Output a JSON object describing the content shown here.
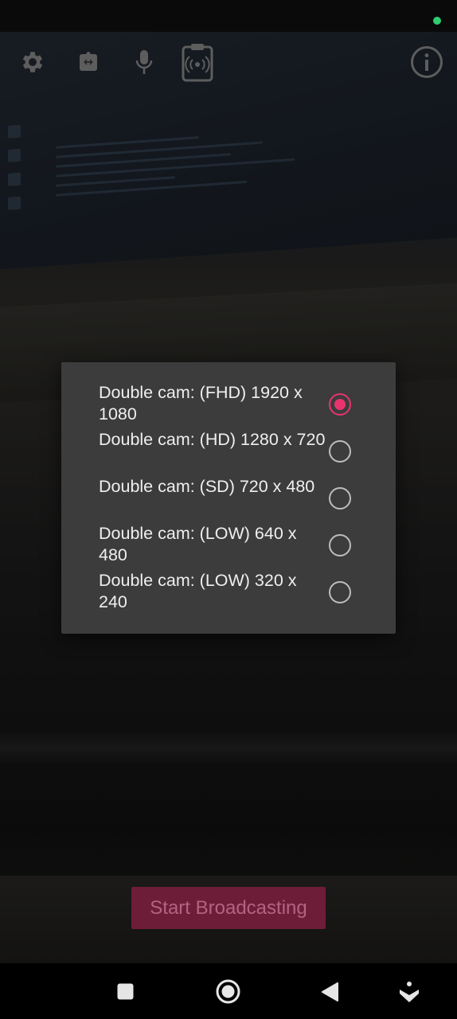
{
  "colors": {
    "accent": "#e8336f",
    "dialog_bg": "#3c3c3c",
    "status_dot": "#2ecc71",
    "start_button_bg": "#6e1d39",
    "start_button_text": "#b16480"
  },
  "toolbar": {
    "icons": [
      "gear-icon",
      "switch-camera-icon",
      "microphone-icon",
      "clipboard-broadcast-icon",
      "info-icon"
    ]
  },
  "dialog": {
    "options": [
      {
        "label": "Double cam: (FHD) 1920 x 1080",
        "selected": true
      },
      {
        "label": "Double cam: (HD) 1280 x 720",
        "selected": false
      },
      {
        "label": "Double cam: (SD) 720 x 480",
        "selected": false
      },
      {
        "label": "Double cam: (LOW) 640 x 480",
        "selected": false
      },
      {
        "label": "Double cam: (LOW) 320 x 240",
        "selected": false
      }
    ]
  },
  "start_button": {
    "label": "Start Broadcasting"
  },
  "nav": {
    "icons": [
      "recents-square-icon",
      "home-circle-icon",
      "back-triangle-icon",
      "assist-down-icon"
    ]
  }
}
